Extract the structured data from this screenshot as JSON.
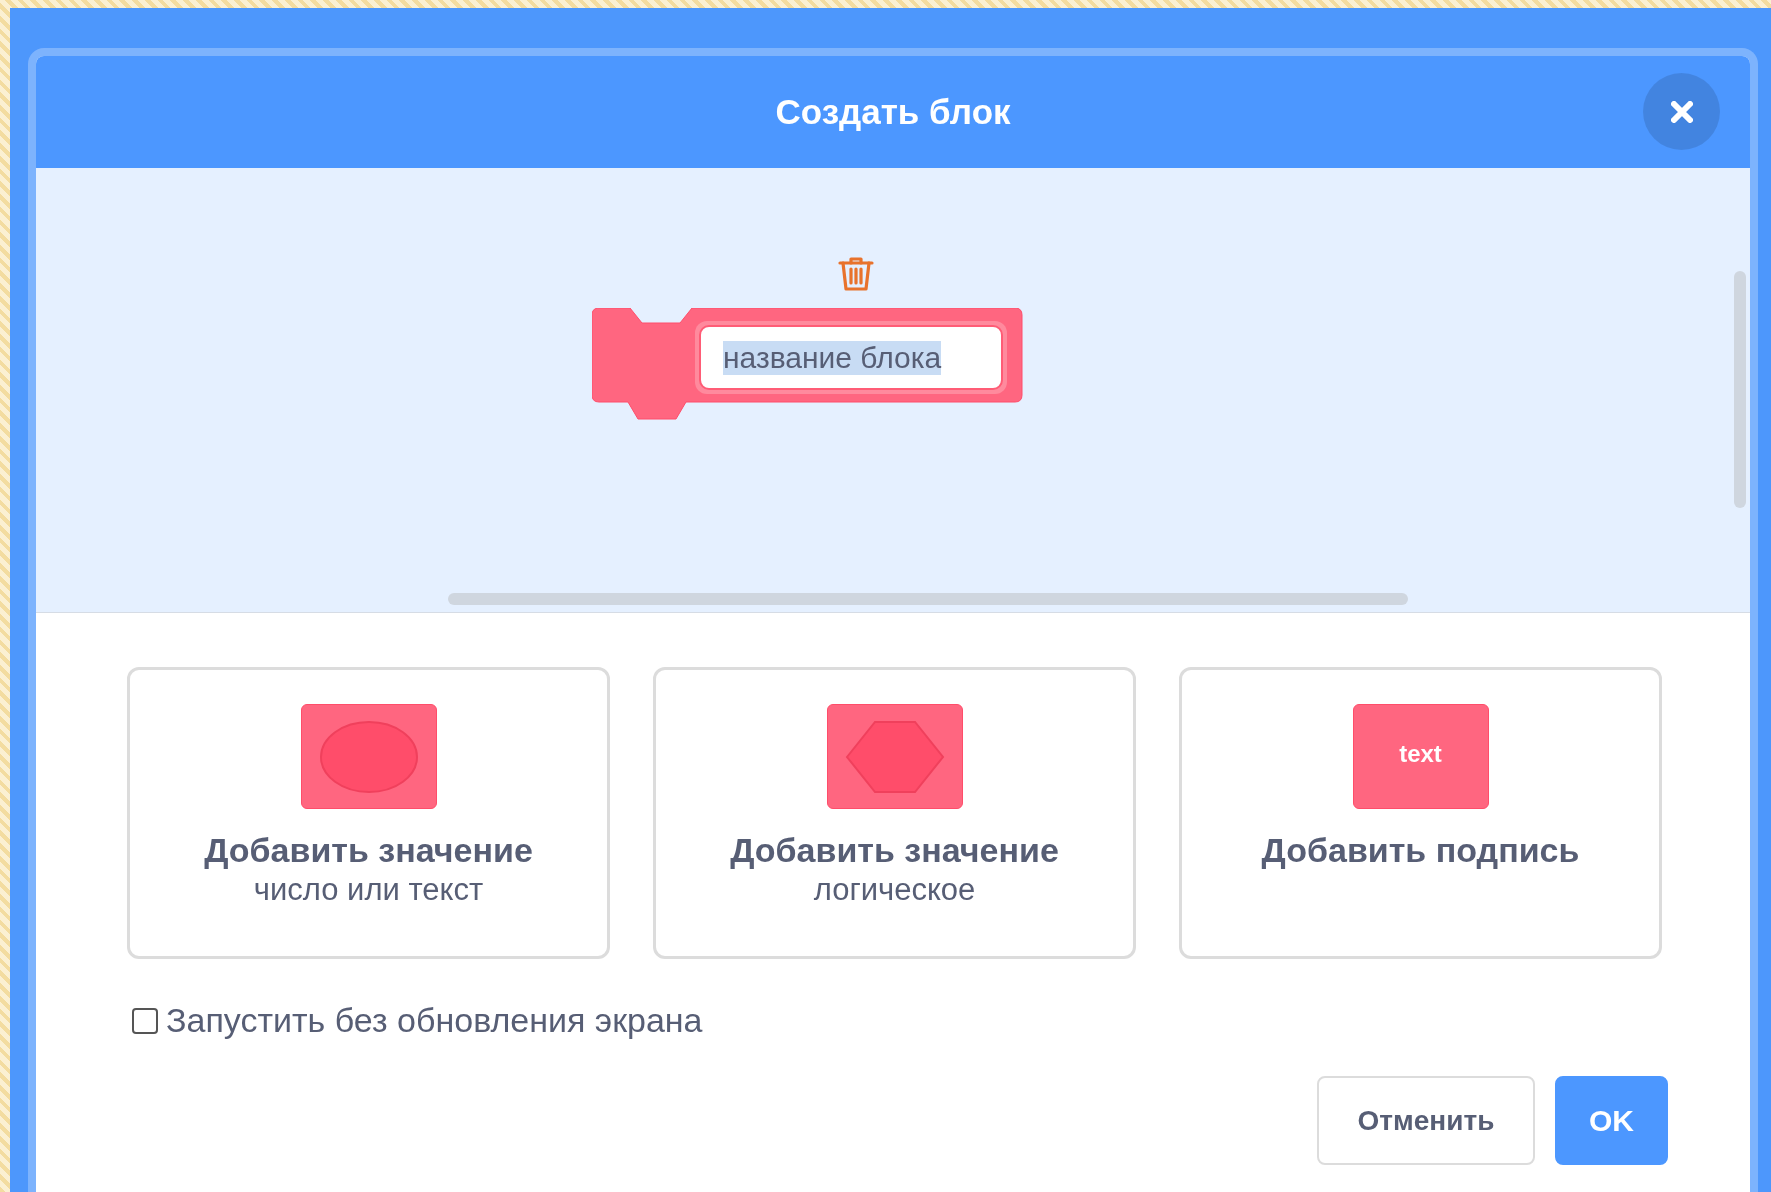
{
  "dialog": {
    "title": "Создать блок"
  },
  "block": {
    "name": "название блока",
    "name_highlighted": true
  },
  "options": [
    {
      "kind": "round-input",
      "title": "Добавить значение",
      "subtitle": "число или текст"
    },
    {
      "kind": "boolean-input",
      "title": "Добавить значение",
      "subtitle": "логическое"
    },
    {
      "kind": "label",
      "title": "Добавить подпись",
      "icon_text": "text"
    }
  ],
  "run_without_refresh": {
    "label": "Запустить без обновления экрана",
    "checked": false
  },
  "buttons": [
    {
      "kind": "secondary",
      "label": "Отменить"
    },
    {
      "kind": "primary",
      "label": "OK"
    }
  ]
}
